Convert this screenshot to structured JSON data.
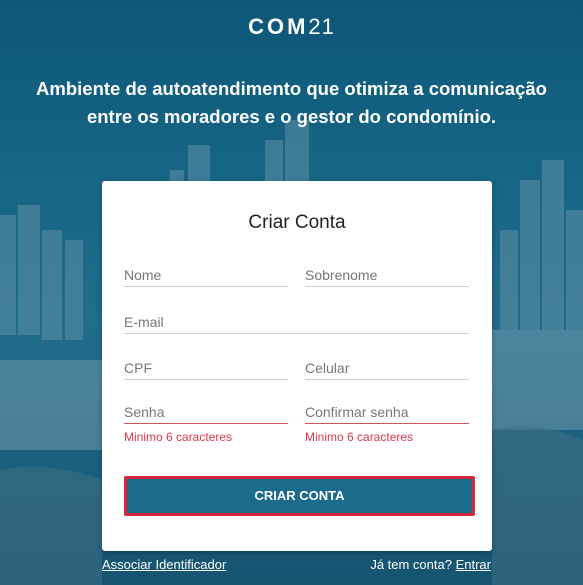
{
  "brand": {
    "logo_bold": "COM",
    "logo_light": "21"
  },
  "header": {
    "tagline_line1": "Ambiente de autoatendimento que otimiza a comunicação",
    "tagline_line2": "entre os moradores e o gestor do condomínio."
  },
  "form": {
    "title": "Criar Conta",
    "first_name_placeholder": "Nome",
    "last_name_placeholder": "Sobrenome",
    "email_placeholder": "E-mail",
    "cpf_placeholder": "CPF",
    "phone_placeholder": "Celular",
    "password_placeholder": "Senha",
    "confirm_password_placeholder": "Confirmar senha",
    "password_error": "Minimo 6 caracteres",
    "confirm_password_error": "Minimo 6 caracteres",
    "submit_label": "CRIAR CONTA"
  },
  "footer": {
    "associate_link": "Associar Identificador",
    "have_account_text": "Já tem conta?",
    "login_link": "Entrar"
  },
  "colors": {
    "primary": "#1d6b8c",
    "error": "#d8394a",
    "button_border": "#d8273b"
  }
}
